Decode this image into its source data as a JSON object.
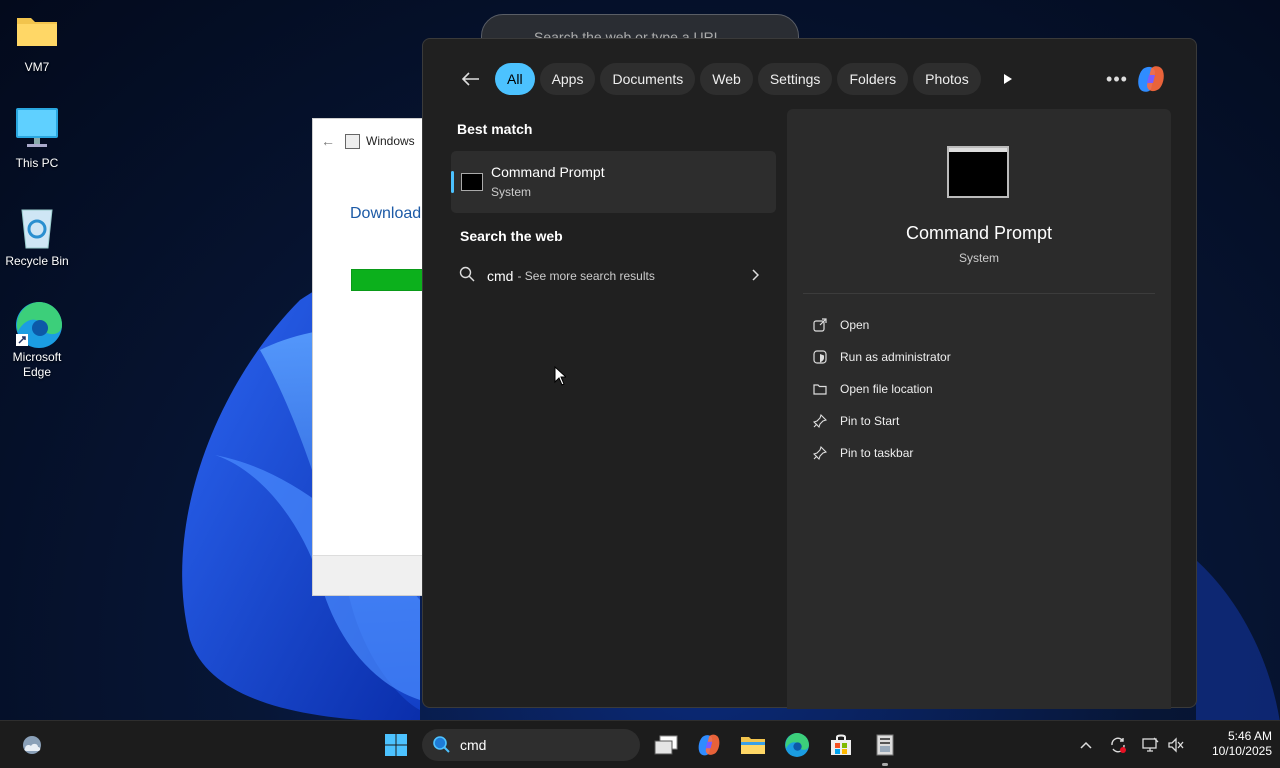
{
  "desktop": {
    "icons": [
      {
        "label": "VM7",
        "icon": "folder-icon"
      },
      {
        "label": "This PC",
        "icon": "monitor-icon"
      },
      {
        "label": "Recycle Bin",
        "icon": "recycle-bin-icon"
      },
      {
        "label": "Microsoft Edge",
        "icon": "edge-icon"
      }
    ]
  },
  "background_window": {
    "title": "Windows",
    "link_text": "Download"
  },
  "edge_address_bar": {
    "placeholder": "Search the web or type a URL"
  },
  "search_panel": {
    "tabs": [
      {
        "label": "All",
        "active": true
      },
      {
        "label": "Apps",
        "active": false
      },
      {
        "label": "Documents",
        "active": false
      },
      {
        "label": "Web",
        "active": false
      },
      {
        "label": "Settings",
        "active": false
      },
      {
        "label": "Folders",
        "active": false
      },
      {
        "label": "Photos",
        "active": false
      }
    ],
    "best_match_heading": "Best match",
    "best_match": {
      "name": "Command Prompt",
      "type": "System"
    },
    "search_web_heading": "Search the web",
    "web_result": {
      "query": "cmd",
      "suffix": "- See more search results"
    },
    "detail": {
      "name": "Command Prompt",
      "type": "System",
      "actions": [
        {
          "label": "Open",
          "icon": "open-icon"
        },
        {
          "label": "Run as administrator",
          "icon": "shield-icon"
        },
        {
          "label": "Open file location",
          "icon": "folder-open-icon"
        },
        {
          "label": "Pin to Start",
          "icon": "pin-icon"
        },
        {
          "label": "Pin to taskbar",
          "icon": "pin-icon"
        }
      ]
    },
    "accent_color": "#4cc2ff"
  },
  "taskbar": {
    "search_value": "cmd",
    "time": "5:46 AM",
    "date": "10/10/2025"
  }
}
